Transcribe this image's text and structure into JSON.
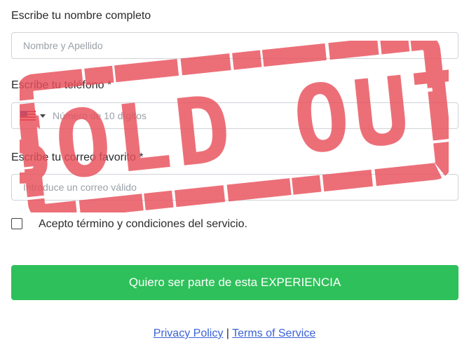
{
  "form": {
    "name_label": "Escribe tu nombre completo",
    "name_placeholder": "Nombre y Apellido",
    "phone_label": "Escribe tu teléfono *",
    "phone_country_icon": "us-flag-icon",
    "phone_placeholder": "Número de 10 dígitos",
    "email_label": "Escribe tu correo favorito *",
    "email_placeholder": "Introduce un correo válido",
    "terms_label": "Acepto término y condiciones del servicio.",
    "terms_checked": false,
    "submit_label": "Quiero ser parte de esta EXPERIENCIA"
  },
  "footer": {
    "privacy_label": "Privacy Policy",
    "separator": "|",
    "terms_label": "Terms of Service"
  },
  "overlay": {
    "stamp_text": "SOLD OUT",
    "stamp_color": "#e8505b"
  },
  "colors": {
    "submit_bg": "#2ec05a",
    "link": "#3a62d8"
  }
}
